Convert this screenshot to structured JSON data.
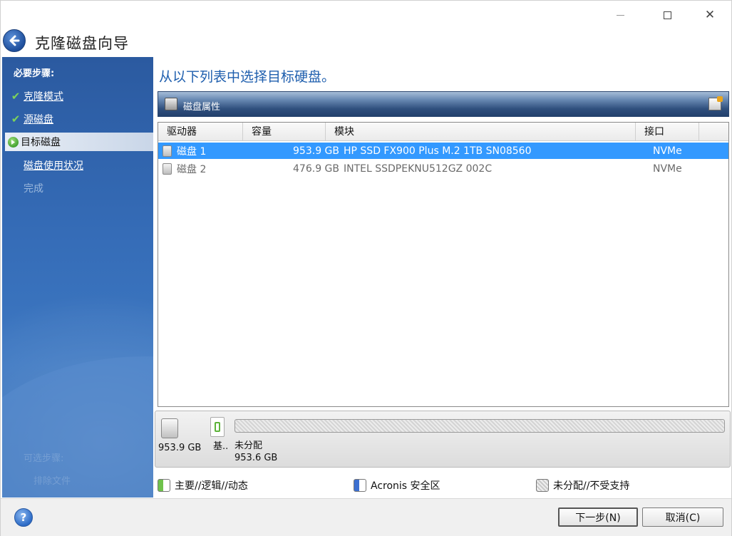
{
  "window": {
    "title": "克隆磁盘向导",
    "controls": {
      "minimize": "—",
      "maximize": "☐",
      "close": "✕"
    }
  },
  "sidebar": {
    "heading": "必要步骤:",
    "steps": [
      {
        "label": "克隆模式",
        "state": "done"
      },
      {
        "label": "源磁盘",
        "state": "done"
      },
      {
        "label": "目标磁盘",
        "state": "current"
      },
      {
        "label": "磁盘使用状况",
        "state": "link"
      },
      {
        "label": "完成",
        "state": "disabled"
      }
    ],
    "faded": [
      "可选步骤:",
      "排除文件"
    ]
  },
  "main": {
    "title": "从以下列表中选择目标硬盘。",
    "properties_label": "磁盘属性",
    "table": {
      "headers": [
        "驱动器",
        "容量",
        "模块",
        "接口",
        ""
      ],
      "rows": [
        {
          "drive": "磁盘 1",
          "capacity": "953.9 GB",
          "model": "HP SSD FX900 Plus M.2 1TB SN08560",
          "interface": "NVMe",
          "selected": true
        },
        {
          "drive": "磁盘 2",
          "capacity": "476.9 GB",
          "model": "INTEL SSDPEKNU512GZ 002C",
          "interface": "NVMe",
          "selected": false
        }
      ]
    },
    "disk_map": {
      "disk_size": "953.9 GB",
      "partition_short": "基..",
      "unallocated_label": "未分配",
      "unallocated_size": "953.6 GB"
    },
    "legend": [
      {
        "label": "主要//逻辑//动态",
        "color": "#6fc24b"
      },
      {
        "label": "Acronis 安全区",
        "color": "#3c6fd0"
      },
      {
        "label": "未分配//不受支持",
        "color": "#c9c9c9"
      }
    ]
  },
  "footer": {
    "help": "?",
    "next_label": "下一步(N)",
    "cancel_label": "取消(C)"
  }
}
